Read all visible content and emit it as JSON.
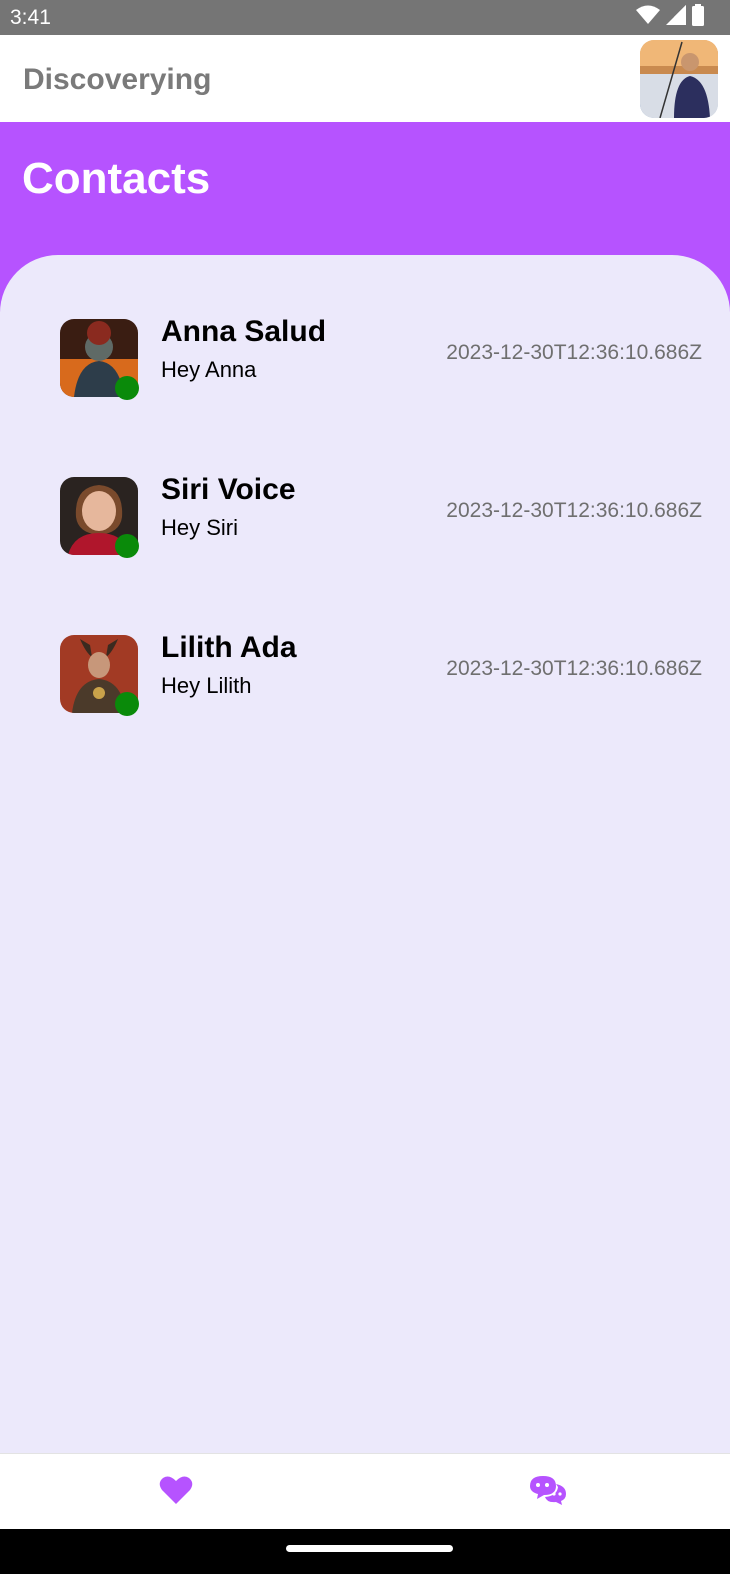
{
  "status_bar": {
    "time": "3:41",
    "icons": [
      "wifi-icon",
      "signal-icon",
      "battery-icon"
    ]
  },
  "app_bar": {
    "title": "Discoverying",
    "profile_avatar": "profile-avatar"
  },
  "header": {
    "title": "Contacts"
  },
  "contacts": [
    {
      "name": "Anna Salud",
      "message": "Hey Anna",
      "timestamp": "2023-12-30T12:36:10.686Z",
      "online": true
    },
    {
      "name": "Siri Voice",
      "message": "Hey Siri",
      "timestamp": "2023-12-30T12:36:10.686Z",
      "online": true
    },
    {
      "name": "Lilith Ada",
      "message": "Hey Lilith",
      "timestamp": "2023-12-30T12:36:10.686Z",
      "online": true
    }
  ],
  "bottom_nav": {
    "items": [
      {
        "icon": "heart-icon",
        "active": true
      },
      {
        "icon": "chat-bubbles-icon",
        "active": false
      }
    ]
  },
  "colors": {
    "accent": "#b653ff",
    "background": "#ece9fb",
    "online": "#0a8a0a",
    "status_bar": "#757575"
  }
}
